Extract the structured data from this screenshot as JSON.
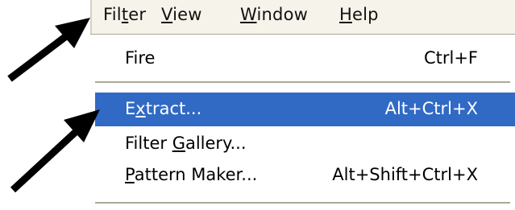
{
  "menubar": {
    "items": [
      {
        "pre": "Fil",
        "u": "t",
        "post": "er"
      },
      {
        "pre": "",
        "u": "V",
        "post": "iew"
      },
      {
        "pre": "",
        "u": "W",
        "post": "indow"
      },
      {
        "pre": "",
        "u": "H",
        "post": "elp"
      }
    ]
  },
  "menu": {
    "fire": {
      "label": "Fire",
      "shortcut": "Ctrl+F"
    },
    "extract": {
      "pre": "E",
      "u": "x",
      "post": "tract...",
      "shortcut": "Alt+Ctrl+X"
    },
    "filter_gallery": {
      "pre": "Filter ",
      "u": "G",
      "post": "allery..."
    },
    "pattern_maker": {
      "pre": "",
      "u": "P",
      "post": "attern Maker...",
      "shortcut": "Alt+Shift+Ctrl+X"
    }
  },
  "colors": {
    "highlight": "#316ac5",
    "menubar_bg": "#f5f3ea"
  },
  "annotations": [
    "arrow-icon",
    "arrow-icon"
  ]
}
